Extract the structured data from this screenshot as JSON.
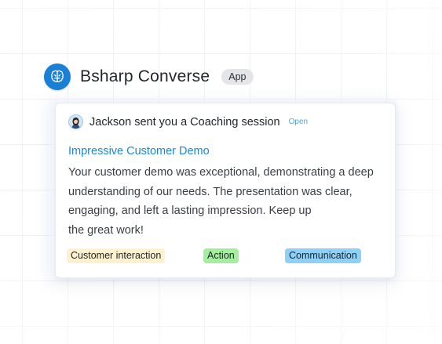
{
  "app": {
    "name": "Bsharp Converse",
    "badge": "App",
    "logo_icon": "brain-icon",
    "brand_color": "#1a7fd6"
  },
  "notification": {
    "sender_text": "Jackson sent you a Coaching session",
    "open_label": "Open",
    "title": "Impressive Customer Demo",
    "body_lines": [
      "Your customer demo was exceptional, demonstrating a deep",
      "understanding of our needs. The presentation was clear,",
      "engaging, and left a lasting impression. Keep up",
      "the great work!"
    ],
    "tags": [
      {
        "label": "Customer interaction",
        "color": "#fdf1cf"
      },
      {
        "label": "Action",
        "color": "#a6ee9f"
      },
      {
        "label": "Communication",
        "color": "#8fd0f6"
      }
    ]
  }
}
